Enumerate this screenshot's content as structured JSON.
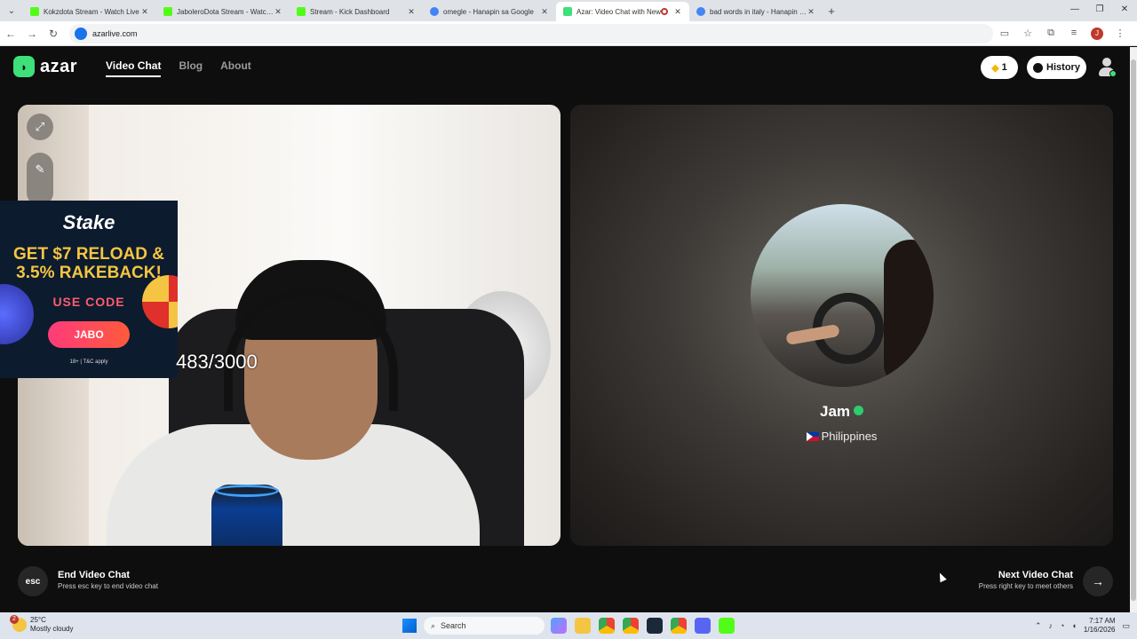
{
  "browser": {
    "tabs": [
      {
        "title": "Kokzdota Stream - Watch Live",
        "color": "#53fc18"
      },
      {
        "title": "JaboleroDota Stream - Watch Live",
        "color": "#53fc18"
      },
      {
        "title": "Stream - Kick Dashboard",
        "color": "#53fc18"
      },
      {
        "title": "omegle - Hanapin sa Google",
        "color": "#4285f4"
      },
      {
        "title": "Azar: Video Chat with New",
        "color": "#3ee07a"
      },
      {
        "title": "bad words in italy - Hanapin sa Google",
        "color": "#4285f4"
      }
    ],
    "url": "azarlive.com",
    "profile_initial": "J"
  },
  "header": {
    "logo": "azar",
    "nav": [
      "Video Chat",
      "Blog",
      "About"
    ],
    "gems": "1",
    "history_label": "History"
  },
  "left_panel": {
    "overlay_count": "483/3000",
    "ad": {
      "brand": "Stake",
      "headline": "GET $7 RELOAD & 3.5% RAKEBACK!",
      "use_code": "USE CODE",
      "code": "JABO",
      "fine_print": "18+ | T&C apply"
    }
  },
  "right_panel": {
    "name": "Jam",
    "country": "Philippines"
  },
  "controls": {
    "esc_key": "esc",
    "end_title": "End Video Chat",
    "end_sub": "Press esc key to end video chat",
    "next_title": "Next Video Chat",
    "next_sub": "Press right key to meet others"
  },
  "taskbar": {
    "weather_temp": "25°C",
    "weather_desc": "Mostly cloudy",
    "weather_badge": "2",
    "search_placeholder": "Search",
    "time": "7:17 AM",
    "date": "1/16/2026"
  }
}
